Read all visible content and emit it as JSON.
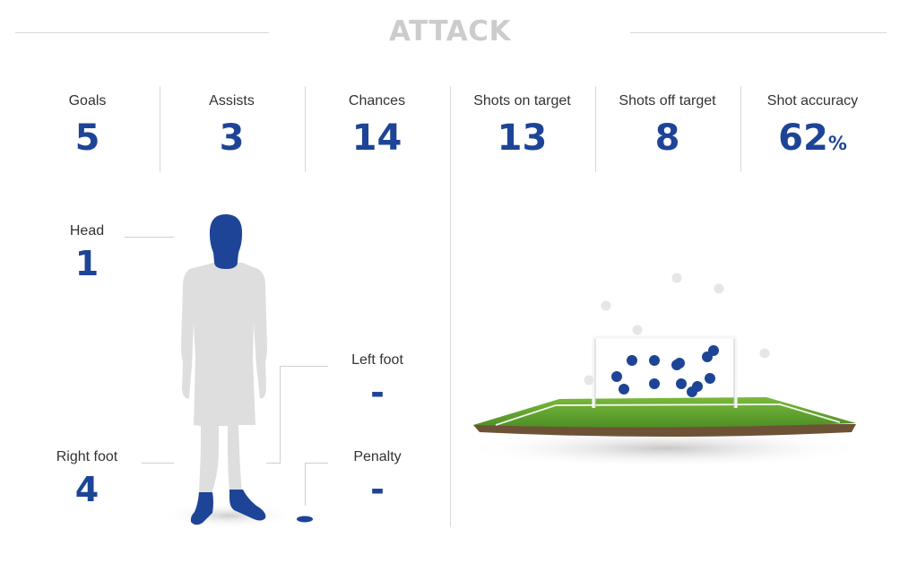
{
  "header": {
    "title": "ATTACK"
  },
  "stats": [
    {
      "label": "Goals",
      "value": "5",
      "unit": ""
    },
    {
      "label": "Assists",
      "value": "3",
      "unit": ""
    },
    {
      "label": "Chances",
      "value": "14",
      "unit": ""
    },
    {
      "label": "Shots on target",
      "value": "13",
      "unit": ""
    },
    {
      "label": "Shots off target",
      "value": "8",
      "unit": ""
    },
    {
      "label": "Shot accuracy",
      "value": "62",
      "unit": "%"
    }
  ],
  "body_stats": {
    "head": {
      "label": "Head",
      "value": "1"
    },
    "right_foot": {
      "label": "Right foot",
      "value": "4"
    },
    "left_foot": {
      "label": "Left foot",
      "value": "-"
    },
    "penalty": {
      "label": "Penalty",
      "value": "-"
    }
  },
  "colors": {
    "accent": "#1d4496",
    "silhouette": "#dedede",
    "title": "#cccccc",
    "off_target": "#e6e6e6",
    "grass": "#63a32e"
  }
}
